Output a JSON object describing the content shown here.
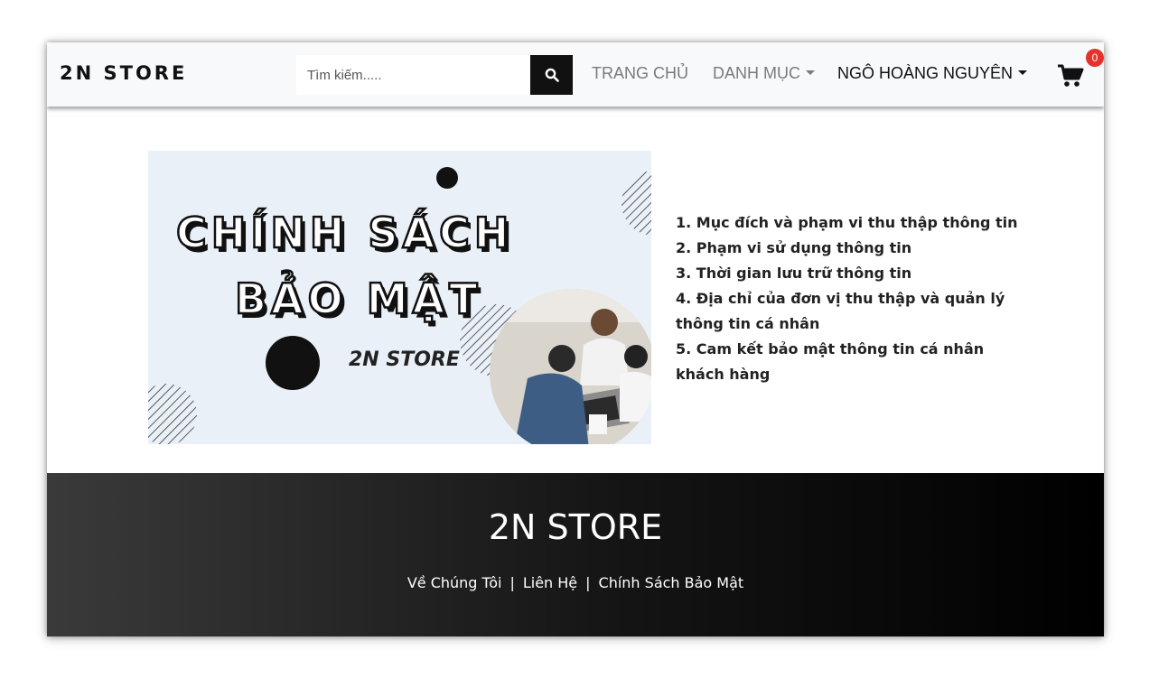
{
  "header": {
    "brand": "2N STORE",
    "search": {
      "placeholder": "Tìm kiếm.....",
      "value": ""
    },
    "nav": {
      "home": "TRANG CHỦ",
      "category": "DANH MỤC",
      "user": "NGÔ HOÀNG NGUYÊN"
    },
    "cart_count": "0",
    "icons": {
      "search": "search-icon",
      "cart": "cart-icon"
    }
  },
  "banner": {
    "title_line1": "CHÍNH SÁCH",
    "title_line2": "BẢO MẬT",
    "brand": "2N STORE"
  },
  "policy_items": [
    "1. Mục đích và phạm vi thu thập thông tin",
    "2. Phạm vi sử dụng thông tin",
    "3. Thời gian lưu trữ thông tin",
    "4. Địa chỉ của đơn vị thu thập và quản lý thông tin cá nhân",
    "5. Cam kết bảo mật thông tin cá nhân khách hàng"
  ],
  "footer": {
    "title": "2N STORE",
    "links": [
      "Về Chúng Tôi",
      "Liên Hệ",
      "Chính Sách Bảo Mật"
    ],
    "separator": "|"
  },
  "colors": {
    "badge": "#e5322d",
    "navbar_bg": "#f8f9fa",
    "footer_dark": "#000000",
    "banner_bg": "#eaf0f8"
  }
}
